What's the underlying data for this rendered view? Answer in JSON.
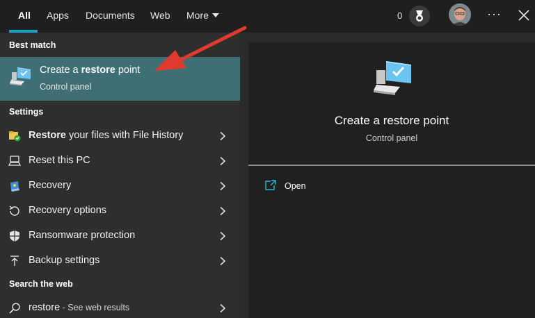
{
  "tabs": [
    {
      "label": "All",
      "active": true
    },
    {
      "label": "Apps"
    },
    {
      "label": "Documents"
    },
    {
      "label": "Web"
    },
    {
      "label": "More"
    }
  ],
  "header": {
    "points": "0",
    "icons": [
      "medal-icon",
      "avatar",
      "more-options-icon",
      "close-icon"
    ]
  },
  "left": {
    "best_match_heading": "Best match",
    "best_match": {
      "title_pre": "Create a ",
      "title_bold": "restore",
      "title_post": " point",
      "subtitle": "Control panel",
      "icon": "computer-check-icon"
    },
    "settings_heading": "Settings",
    "settings": [
      {
        "bold": "Restore",
        "rest": " your files with File History",
        "icon": "file-history-icon"
      },
      {
        "bold": "",
        "rest": "Reset this PC",
        "icon": "reset-pc-icon"
      },
      {
        "bold": "",
        "rest": "Recovery",
        "icon": "recovery-icon"
      },
      {
        "bold": "",
        "rest": "Recovery options",
        "icon": "recovery-options-icon"
      },
      {
        "bold": "",
        "rest": "Ransomware protection",
        "icon": "shield-icon"
      },
      {
        "bold": "",
        "rest": "Backup settings",
        "icon": "backup-icon"
      }
    ],
    "web_heading": "Search the web",
    "web": {
      "query": "restore",
      "suffix": " - See web results",
      "icon": "search-icon"
    }
  },
  "right": {
    "title": "Create a restore point",
    "subtitle": "Control panel",
    "open_label": "Open"
  },
  "colors": {
    "accent": "#1aa3c9",
    "highlight": "#3f6f75",
    "arrow": "#e03a2f"
  }
}
